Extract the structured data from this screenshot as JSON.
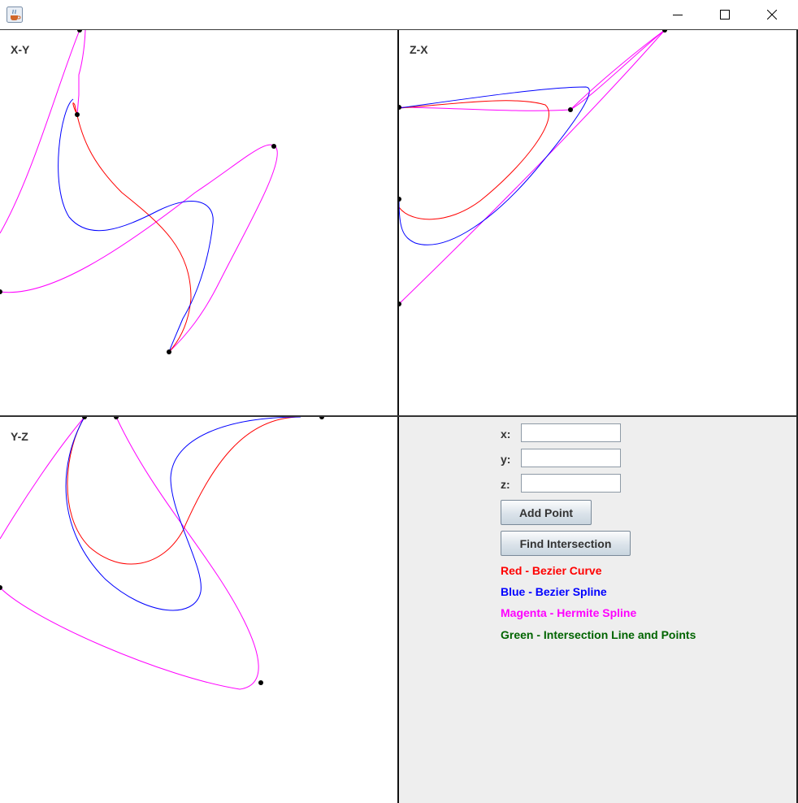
{
  "window": {
    "icon": "java-coffee-icon",
    "minimize_icon": "minimize-icon",
    "maximize_icon": "maximize-icon",
    "close_icon": "close-icon"
  },
  "views": {
    "xy": {
      "label": "X-Y"
    },
    "zx": {
      "label": "Z-X"
    },
    "yz": {
      "label": "Y-Z"
    }
  },
  "controls": {
    "x_label": "x:",
    "y_label": "y:",
    "z_label": "z:",
    "x_value": "",
    "y_value": "",
    "z_value": "",
    "add_point_label": "Add Point",
    "find_intersection_label": "Find Intersection"
  },
  "legend": [
    {
      "text": "Red - Bezier Curve",
      "color": "#ff0000"
    },
    {
      "text": "Blue - Bezier Spline",
      "color": "#0000ff"
    },
    {
      "text": "Magenta - Hermite Spline",
      "color": "#ff00ff"
    },
    {
      "text": "Green - Intersection Line and Points",
      "color": "#006400"
    }
  ],
  "colors": {
    "bezier_curve": "#ff0000",
    "bezier_spline": "#0000ff",
    "hermite_spline": "#ff00ff",
    "control_point": "#000000",
    "panel_background": "#eeeeee"
  }
}
